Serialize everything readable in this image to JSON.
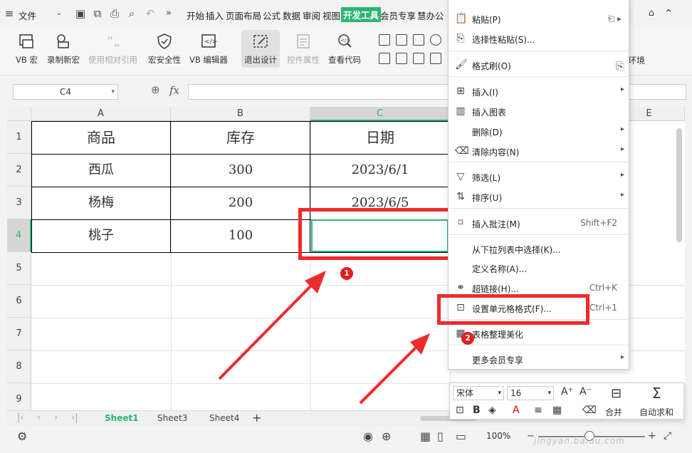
{
  "menubar": {
    "file": "文件",
    "tabs": [
      "开始",
      "插入",
      "页面布局",
      "公式",
      "数据",
      "审阅",
      "视图",
      "开发工具",
      "会员专享",
      "慧办公"
    ],
    "active_tab": "开发工具"
  },
  "ribbon": {
    "vb_macro": "VB 宏",
    "record_macro": "录制新宏",
    "relative_ref": "使用相对引用",
    "macro_security": "宏安全性",
    "vb_editor": "VB 编辑器",
    "exit_design": "退出设计",
    "control_props": "控件属性",
    "view_code": "查看代码",
    "env": "环境"
  },
  "formula_bar": {
    "name_box": "C4",
    "fx": "fx",
    "formula": ""
  },
  "grid": {
    "columns": [
      "A",
      "B",
      "C",
      "E"
    ],
    "rows": [
      "1",
      "2",
      "3",
      "4",
      "5",
      "6",
      "7",
      "8",
      "9"
    ],
    "table": [
      [
        "商品",
        "库存",
        "日期"
      ],
      [
        "西瓜",
        "300",
        "2023/6/1"
      ],
      [
        "杨梅",
        "200",
        "2023/6/5"
      ],
      [
        "桃子",
        "100",
        ""
      ]
    ],
    "active_cell": "C4"
  },
  "sheets": {
    "tabs": [
      "Sheet1",
      "Sheet3",
      "Sheet4"
    ],
    "active": "Sheet1",
    "add": "+"
  },
  "status": {
    "zoom": "100%"
  },
  "context_menu": {
    "items": [
      {
        "label": "粘贴(P)",
        "shortcut": "",
        "submenu": false
      },
      {
        "label": "选择性粘贴(S)...",
        "shortcut": "",
        "submenu": false
      },
      {
        "label": "格式刷(O)",
        "shortcut": "",
        "submenu": false
      },
      {
        "label": "插入(I)",
        "shortcut": "",
        "submenu": true
      },
      {
        "label": "插入图表",
        "shortcut": "",
        "submenu": false
      },
      {
        "label": "删除(D)",
        "shortcut": "",
        "submenu": true
      },
      {
        "label": "清除内容(N)",
        "shortcut": "",
        "submenu": true
      },
      {
        "label": "筛选(L)",
        "shortcut": "",
        "submenu": true
      },
      {
        "label": "排序(U)",
        "shortcut": "",
        "submenu": true
      },
      {
        "label": "插入批注(M)",
        "shortcut": "Shift+F2",
        "submenu": false
      },
      {
        "label": "从下拉列表中选择(K)...",
        "shortcut": "",
        "submenu": false
      },
      {
        "label": "定义名称(A)...",
        "shortcut": "",
        "submenu": false
      },
      {
        "label": "超链接(H)...",
        "shortcut": "Ctrl+K",
        "submenu": false
      },
      {
        "label": "设置单元格格式(F)...",
        "shortcut": "Ctrl+1",
        "submenu": false
      },
      {
        "label": "表格整理美化",
        "shortcut": "",
        "submenu": false
      },
      {
        "label": "更多会员专享",
        "shortcut": "",
        "submenu": true
      }
    ]
  },
  "mini_toolbar": {
    "font": "宋体",
    "size": "16",
    "merge": "合并",
    "autosum": "自动求和"
  },
  "annotations": {
    "badge1": "1",
    "badge2": "2",
    "accent": "#ee2b2b"
  },
  "watermark": "jingyan.baidu.com"
}
